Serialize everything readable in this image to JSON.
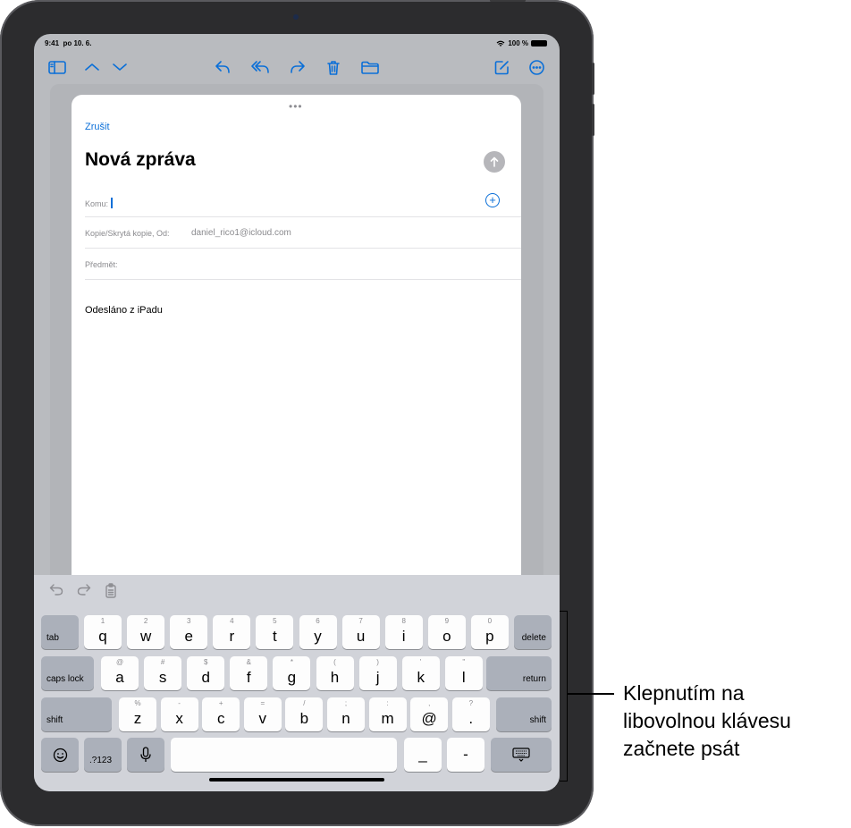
{
  "status": {
    "time": "9:41",
    "date": "po 10. 6.",
    "battery": "100 %"
  },
  "compose": {
    "cancel_label": "Zrušit",
    "title": "Nová zpráva",
    "to_label": "Komu:",
    "cc_label": "Kopie/Skrytá kopie, Od:",
    "from_value": "daniel_rico1@icloud.com",
    "subject_label": "Předmět:",
    "signature": "Odesláno z iPadu"
  },
  "keyboard": {
    "row1": [
      {
        "hint": "1",
        "key": "q"
      },
      {
        "hint": "2",
        "key": "w"
      },
      {
        "hint": "3",
        "key": "e"
      },
      {
        "hint": "4",
        "key": "r"
      },
      {
        "hint": "5",
        "key": "t"
      },
      {
        "hint": "6",
        "key": "y"
      },
      {
        "hint": "7",
        "key": "u"
      },
      {
        "hint": "8",
        "key": "i"
      },
      {
        "hint": "9",
        "key": "o"
      },
      {
        "hint": "0",
        "key": "p"
      }
    ],
    "row2": [
      {
        "hint": "@",
        "key": "a"
      },
      {
        "hint": "#",
        "key": "s"
      },
      {
        "hint": "$",
        "key": "d"
      },
      {
        "hint": "&",
        "key": "f"
      },
      {
        "hint": "*",
        "key": "g"
      },
      {
        "hint": "(",
        "key": "h"
      },
      {
        "hint": ")",
        "key": "j"
      },
      {
        "hint": "'",
        "key": "k"
      },
      {
        "hint": "\"",
        "key": "l"
      }
    ],
    "row3": [
      {
        "hint": "%",
        "key": "z"
      },
      {
        "hint": "-",
        "key": "x"
      },
      {
        "hint": "+",
        "key": "c"
      },
      {
        "hint": "=",
        "key": "v"
      },
      {
        "hint": "/",
        "key": "b"
      },
      {
        "hint": ";",
        "key": "n"
      },
      {
        "hint": ":",
        "key": "m"
      },
      {
        "hint": ",",
        "key": "@"
      },
      {
        "hint": "?",
        "key": "."
      }
    ],
    "tab": "tab",
    "delete": "delete",
    "caps_lock": "caps lock",
    "return": "return",
    "shift": "shift",
    "numbers": ".?123",
    "underscore": "_",
    "dash": "-"
  },
  "callout": {
    "line1": "Klepnutím na",
    "line2": "libovolnou klávesu",
    "line3": "začnete psát"
  },
  "colors": {
    "accent": "#0a6fd8",
    "keyboard_bg": "#d1d3d9",
    "function_key": "#abb0ba"
  },
  "icons": [
    "sidebar-icon",
    "chevron-up-icon",
    "chevron-down-icon",
    "reply-icon",
    "reply-all-icon",
    "forward-icon",
    "trash-icon",
    "folder-icon",
    "compose-icon",
    "more-icon",
    "send-arrow-icon",
    "add-contact-icon",
    "undo-icon",
    "redo-icon",
    "paste-icon",
    "emoji-icon",
    "microphone-icon",
    "hide-keyboard-icon",
    "wifi-icon",
    "battery-icon"
  ]
}
